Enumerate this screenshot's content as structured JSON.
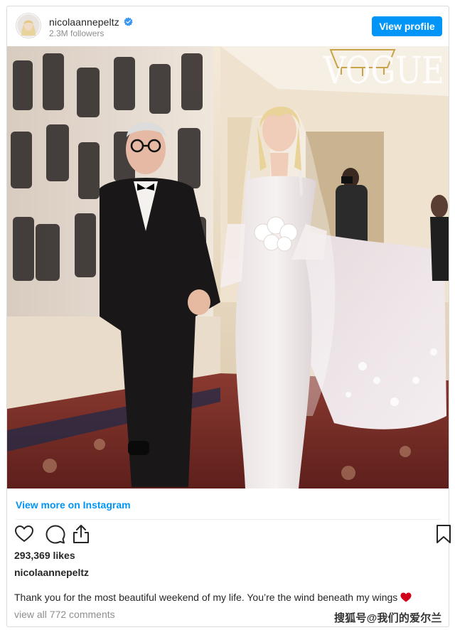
{
  "header": {
    "username": "nicolaannepeltz",
    "followers": "2.3M followers",
    "view_profile_label": "View profile"
  },
  "photo": {
    "magazine_logo": "VOGUE"
  },
  "footer": {
    "view_more_label": "View more on Instagram",
    "likes": "293,369 likes",
    "caption_username": "nicolaannepeltz",
    "caption": "Thank you for the most beautiful weekend of my life. You’re the wind beneath my wings",
    "view_comments": "view all 772 comments"
  },
  "watermark": "搜狐号@我们的爱尔兰",
  "icons": [
    "verified-badge-icon",
    "heart-icon",
    "comment-icon",
    "share-icon",
    "bookmark-icon",
    "red-heart-emoji-icon"
  ],
  "colors": {
    "accent": "#0095f6",
    "text": "#262626",
    "muted": "#8e8e8e",
    "border": "#dbdbdb",
    "emoji_red": "#d0021b"
  }
}
